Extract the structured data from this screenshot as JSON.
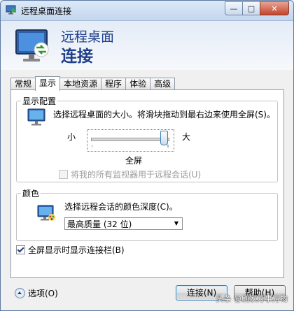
{
  "window": {
    "title": "远程桌面连接",
    "controls": {
      "minimize": "—",
      "maximize": "□",
      "close": "✕"
    }
  },
  "header": {
    "line1": "远程桌面",
    "line2": "连接"
  },
  "tabs": [
    {
      "label": "常规"
    },
    {
      "label": "显示"
    },
    {
      "label": "本地资源"
    },
    {
      "label": "程序"
    },
    {
      "label": "体验"
    },
    {
      "label": "高级"
    }
  ],
  "active_tab": "显示",
  "display": {
    "legend": "显示配置",
    "description": "选择远程桌面的大小。将滑块拖动到最右边来使用全屏(S)。",
    "slider_min_label": "小",
    "slider_max_label": "大",
    "slider_value_fraction": 1.0,
    "slider_value_label": "全屏",
    "use_all_monitors": {
      "label": "将我的所有监视器用于远程会话(U)",
      "checked": false,
      "enabled": false
    }
  },
  "colors": {
    "legend": "颜色",
    "description": "选择远程会话的颜色深度(C)。",
    "selected": "最高质量 (32 位)"
  },
  "connection_bar": {
    "label": "全屏显示时显示连接栏(B)",
    "checked": true
  },
  "footer": {
    "options_label": "选项(O)",
    "connect_label": "连接(N)",
    "help_label": "帮助(H)"
  },
  "watermark": "头条 @刷家万事万物"
}
